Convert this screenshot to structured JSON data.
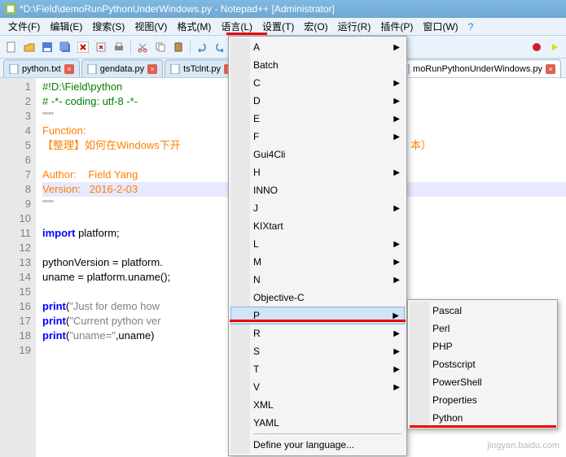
{
  "title": "*D:\\Field\\demoRunPythonUnderWindows.py - Notepad++ [Administrator]",
  "menubar": {
    "items": [
      "文件(F)",
      "编辑(E)",
      "搜索(S)",
      "视图(V)",
      "格式(M)",
      "语言(L)",
      "设置(T)",
      "宏(O)",
      "运行(R)",
      "插件(P)",
      "窗口(W)"
    ],
    "help": "?"
  },
  "tabs": [
    {
      "label": "python.txt"
    },
    {
      "label": "gendata.py"
    },
    {
      "label": "tsTclnt.py"
    },
    {
      "label": "moRunPythonUnderWindows.py",
      "right": true,
      "active": true
    }
  ],
  "code": {
    "lines": [
      {
        "n": 1,
        "seg": [
          {
            "t": "#!D:\\Field\\python",
            "c": "c-comment"
          }
        ]
      },
      {
        "n": 2,
        "seg": [
          {
            "t": "# -*- coding: utf-8 -*-",
            "c": "c-comment"
          }
        ]
      },
      {
        "n": 3,
        "seg": [
          {
            "t": "\"\"\"",
            "c": "c-string"
          }
        ]
      },
      {
        "n": 4,
        "seg": [
          {
            "t": "Function:",
            "c": "c-orangetxt"
          }
        ]
      },
      {
        "n": 5,
        "seg": [
          {
            "t": "【整理】如何在Windows下开",
            "c": "c-orangetxt"
          }
        ],
        "tail": "本）"
      },
      {
        "n": 6,
        "seg": [
          {
            "t": "",
            "c": ""
          }
        ]
      },
      {
        "n": 7,
        "seg": [
          {
            "t": "Author:    Field Yang",
            "c": "c-orangetxt"
          }
        ]
      },
      {
        "n": 8,
        "seg": [
          {
            "t": "Version:   2016-2-03",
            "c": "c-orangetxt"
          }
        ],
        "sel": true
      },
      {
        "n": 9,
        "seg": [
          {
            "t": "\"\"\"",
            "c": "c-string"
          }
        ]
      },
      {
        "n": 10,
        "seg": [
          {
            "t": "",
            "c": ""
          }
        ]
      },
      {
        "n": 11,
        "seg": [
          {
            "t": "import",
            "c": "c-key"
          },
          {
            "t": " platform;",
            "c": "c-id"
          }
        ]
      },
      {
        "n": 12,
        "seg": [
          {
            "t": "",
            "c": ""
          }
        ]
      },
      {
        "n": 13,
        "seg": [
          {
            "t": "pythonVersion = platform.",
            "c": "c-id"
          }
        ]
      },
      {
        "n": 14,
        "seg": [
          {
            "t": "uname = platform.uname();",
            "c": "c-id"
          }
        ]
      },
      {
        "n": 15,
        "seg": [
          {
            "t": "",
            "c": ""
          }
        ]
      },
      {
        "n": 16,
        "seg": [
          {
            "t": "print",
            "c": "c-key"
          },
          {
            "t": "(",
            "c": "c-id"
          },
          {
            "t": "\"Just for demo how ",
            "c": "c-string"
          }
        ]
      },
      {
        "n": 17,
        "seg": [
          {
            "t": "print",
            "c": "c-key"
          },
          {
            "t": "(",
            "c": "c-id"
          },
          {
            "t": "\"Current python ver",
            "c": "c-string"
          }
        ]
      },
      {
        "n": 18,
        "seg": [
          {
            "t": "print",
            "c": "c-key"
          },
          {
            "t": "(",
            "c": "c-id"
          },
          {
            "t": "\"uname=\"",
            "c": "c-string"
          },
          {
            "t": ",uname)",
            "c": "c-id"
          }
        ]
      },
      {
        "n": 19,
        "seg": [
          {
            "t": "",
            "c": ""
          }
        ]
      }
    ]
  },
  "menu1": [
    {
      "label": "A",
      "sub": true
    },
    {
      "label": "Batch"
    },
    {
      "label": "C",
      "sub": true
    },
    {
      "label": "D",
      "sub": true
    },
    {
      "label": "E",
      "sub": true
    },
    {
      "label": "F",
      "sub": true
    },
    {
      "label": "Gui4Cli"
    },
    {
      "label": "H",
      "sub": true
    },
    {
      "label": "INNO"
    },
    {
      "label": "J",
      "sub": true
    },
    {
      "label": "KIXtart"
    },
    {
      "label": "L",
      "sub": true
    },
    {
      "label": "M",
      "sub": true
    },
    {
      "label": "N",
      "sub": true
    },
    {
      "label": "Objective-C"
    },
    {
      "label": "P",
      "sub": true,
      "hover": true
    },
    {
      "label": "R",
      "sub": true
    },
    {
      "label": "S",
      "sub": true
    },
    {
      "label": "T",
      "sub": true
    },
    {
      "label": "V",
      "sub": true
    },
    {
      "label": "XML"
    },
    {
      "label": "YAML"
    },
    {
      "sep": true
    },
    {
      "label": "Define your language..."
    }
  ],
  "menu2": [
    {
      "label": "Pascal"
    },
    {
      "label": "Perl"
    },
    {
      "label": "PHP"
    },
    {
      "label": "Postscript"
    },
    {
      "label": "PowerShell"
    },
    {
      "label": "Properties"
    },
    {
      "label": "Python"
    }
  ],
  "watermark": "jingyan.baidu.com"
}
